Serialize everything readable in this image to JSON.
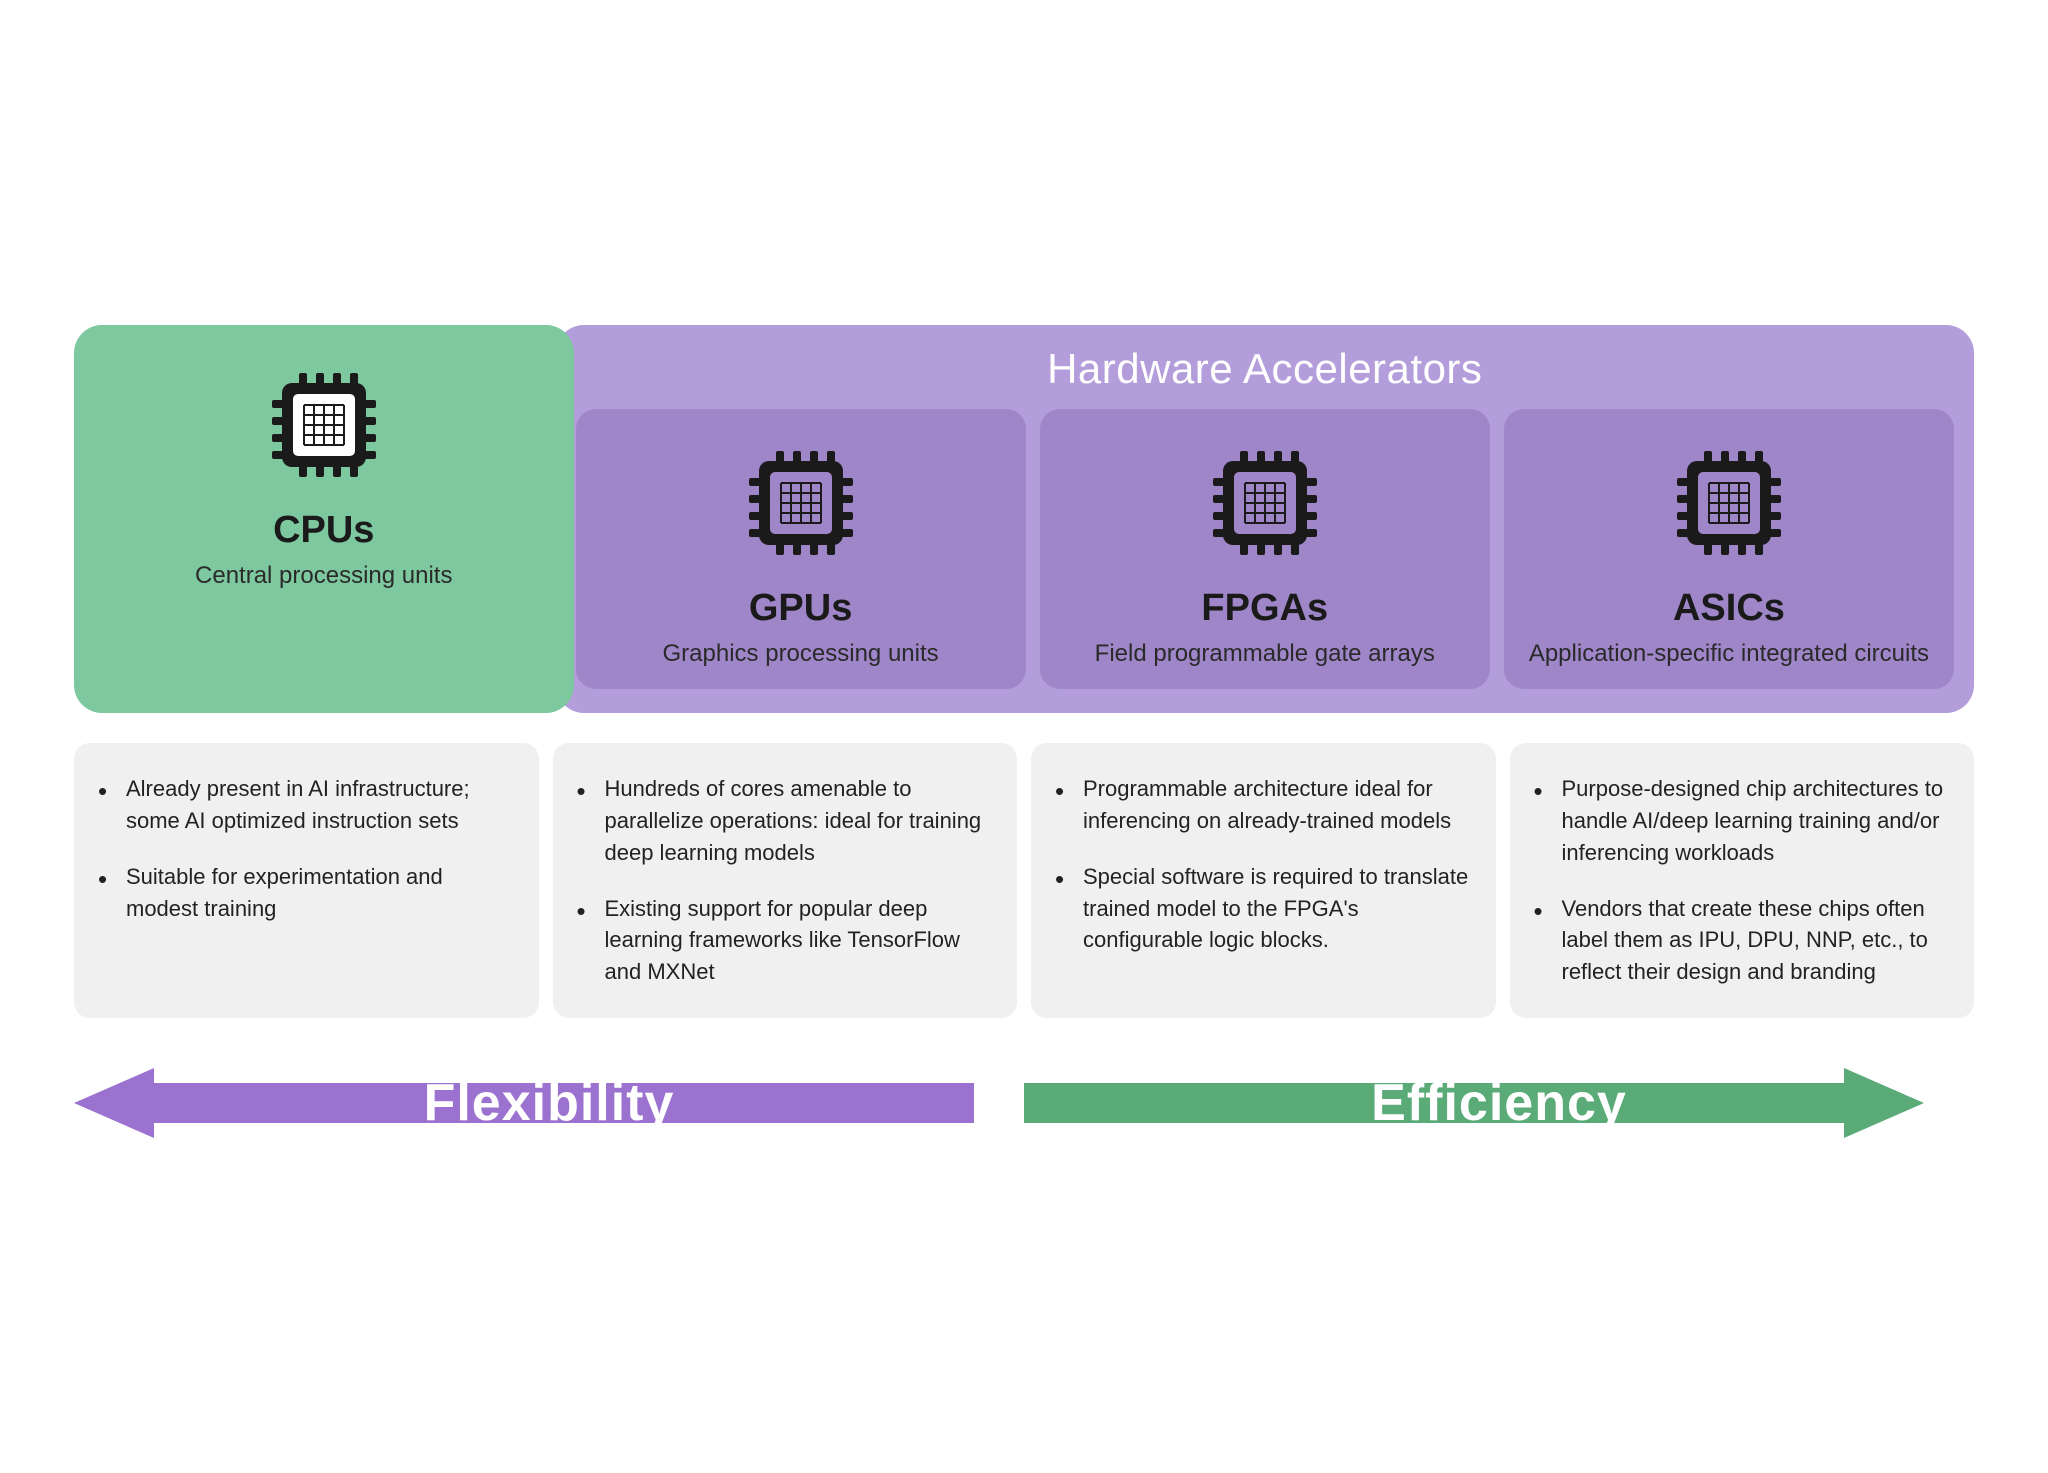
{
  "hw_title": "Hardware Accelerators",
  "chips": [
    {
      "id": "cpu",
      "abbr": "CPUs",
      "full": "Central processing units",
      "color_bg": "#7ec8a0",
      "color_card": "#7ec8a0"
    },
    {
      "id": "gpu",
      "abbr": "GPUs",
      "full": "Graphics processing units",
      "color_bg": "#9e86c8",
      "color_card": "#9e86c8"
    },
    {
      "id": "fpga",
      "abbr": "FPGAs",
      "full": "Field programmable gate arrays",
      "color_bg": "#9e86c8",
      "color_card": "#9e86c8"
    },
    {
      "id": "asic",
      "abbr": "ASICs",
      "full": "Application-specific integrated circuits",
      "color_bg": "#9e86c8",
      "color_card": "#9e86c8"
    }
  ],
  "bullets": [
    {
      "id": "cpu",
      "points": [
        "Already present in AI infrastructure; some AI optimized instruction sets",
        "Suitable for experimentation and modest training"
      ]
    },
    {
      "id": "gpu",
      "points": [
        "Hundreds of cores amenable to parallelize operations: ideal for training deep learning models",
        "Existing support for popular deep learning frameworks like TensorFlow and MXNet"
      ]
    },
    {
      "id": "fpga",
      "points": [
        "Programmable architecture ideal for inferencing on already-trained models",
        "Special software is required to translate trained model to the FPGA's configurable logic blocks."
      ]
    },
    {
      "id": "asic",
      "points": [
        "Purpose-designed chip architectures to handle AI/deep learning training and/or inferencing workloads",
        "Vendors that create these chips often label them as IPU, DPU, NNP, etc., to reflect their design and branding"
      ]
    }
  ],
  "arrows": {
    "left_label": "Flexibility",
    "right_label": "Efficiency"
  }
}
